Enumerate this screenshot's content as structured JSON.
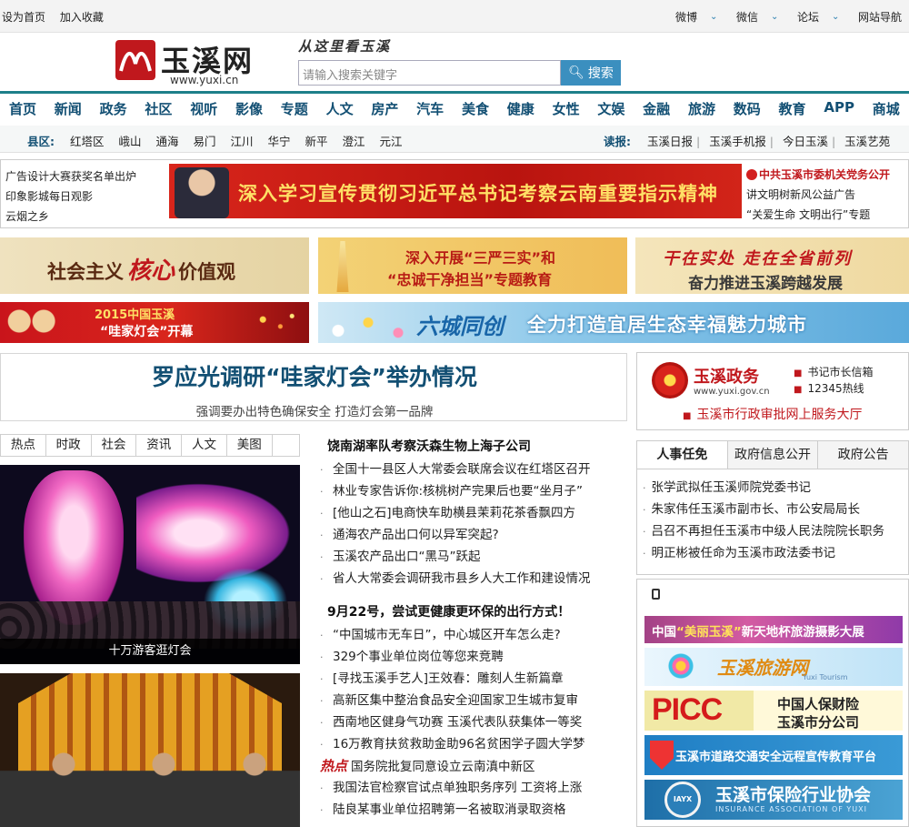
{
  "topbar": {
    "set_home": "设为首页",
    "bookmark": "加入收藏",
    "weibo": "微博",
    "weixin": "微信",
    "forum": "论坛",
    "site_nav": "网站导航"
  },
  "header": {
    "logo_name": "玉溪网",
    "logo_url": "www.yuxi.cn",
    "slogan": "从这里看玉溪",
    "search_placeholder": "请输入搜索关键字",
    "search_button": "搜索"
  },
  "nav": {
    "items": [
      "首页",
      "新闻",
      "政务",
      "社区",
      "视听",
      "影像",
      "专题",
      "人文",
      "房产",
      "汽车",
      "美食",
      "健康",
      "女性",
      "文娱",
      "金融",
      "旅游",
      "数码",
      "教育",
      "APP",
      "商城"
    ]
  },
  "subnav": {
    "county_label": "县区:",
    "counties": [
      "红塔区",
      "峨山",
      "通海",
      "易门",
      "江川",
      "华宁",
      "新平",
      "澄江",
      "元江"
    ],
    "read_label": "读报:",
    "papers": [
      "玉溪日报",
      "玉溪手机报",
      "今日玉溪",
      "玉溪艺苑"
    ]
  },
  "promo": {
    "left_links": [
      "广告设计大赛获奖名单出炉",
      "印象影城每日观影",
      "云烟之乡"
    ],
    "banner_text": "深入学习宣传贯彻习近平总书记考察云南重要指示精神",
    "right_title": "中共玉溪市委机关党务公开",
    "right_links": [
      "讲文明树新风公益广告",
      "“关爱生命 文明出行”专题"
    ]
  },
  "ads": {
    "ad1_pre": "社会主义",
    "ad1_big": "核心",
    "ad1_post": "价值观",
    "ad2_line1": "深入开展“三严三实”和",
    "ad2_line2": "“忠诚干净担当”专题教育",
    "ad3_line1": "干在实处 走在全省前列",
    "ad3_line2": "奋力推进玉溪跨越发展",
    "ad4_line1": "2015中国玉溪",
    "ad4_line2": "“哇家灯会”开幕",
    "ad5_line1": "六城同创",
    "ad5_line2": "全力打造宜居生态幸福魅力城市"
  },
  "headline": {
    "title": "罗应光调研“哇家灯会”举办情况",
    "subtitle": "强调要办出特色确保安全 打造灯会第一品牌"
  },
  "photo_tabs": [
    "热点",
    "时政",
    "社会",
    "资讯",
    "人文",
    "美图"
  ],
  "photo1_caption": "十万游客逛灯会",
  "news": {
    "head1": "饶南湖率队考察沃森生物上海子公司",
    "group1": [
      "全国十一县区人大常委会联席会议在红塔区召开",
      "林业专家告诉你:核桃树产完果后也要“坐月子”",
      "[他山之石]电商快车助横县茉莉花茶香飘四方",
      "通海农产品出口何以异军突起?",
      "玉溪农产品出口“黑马”跃起",
      "省人大常委会调研我市县乡人大工作和建设情况"
    ],
    "head2": "9月22号，尝试更健康更环保的出行方式！",
    "group2": [
      "“中国城市无车日”，中心城区开车怎么走?",
      "329个事业单位岗位等您来竞聘",
      "[寻找玉溪手艺人]王效春：雕刻人生新篇章",
      "高新区集中整治食品安全迎国家卫生城市复审",
      "西南地区健身气功赛 玉溪代表队获集体一等奖",
      "16万教育扶贫救助金助96名贫困学子圆大学梦"
    ],
    "hot_label": "热点",
    "hot_item": "国务院批复同意设立云南滇中新区",
    "group3": [
      "我国法官检察官试点单独职务序列 工资将上涨",
      "陆良某事业单位招聘第一名被取消录取资格"
    ]
  },
  "gov": {
    "title": "玉溪政务",
    "url": "www.yuxi.gov.cn",
    "link1": "书记市长信箱",
    "link2": "12345热线",
    "link3": "玉溪市行政审批网上服务大厅"
  },
  "rtabs": [
    "人事任免",
    "政府信息公开",
    "政府公告"
  ],
  "rlist": [
    "张学武拟任玉溪师院党委书记",
    "朱家伟任玉溪市副市长、市公安局局长",
    "吕召不再担任玉溪市中级人民法院院长职务",
    "明正彬被任命为玉溪市政法委书记"
  ],
  "rads": {
    "r1_pre": "中国",
    "r1_y": "“美丽玉溪”",
    "r1_post": "新天地杯旅游摄影大展",
    "r2": "玉溪旅游网",
    "r2_sub": "Yuxi Tourism",
    "r3_logo": "PICC",
    "r3_l1": "中国人保财险",
    "r3_l2": "玉溪市分公司",
    "r4": "玉溪市道路交通安全远程宣传教育平台",
    "r5_logo": "IAYX",
    "r5": "玉溪市保险行业协会",
    "r5_sub": "INSURANCE ASSOCIATION OF YUXI"
  }
}
